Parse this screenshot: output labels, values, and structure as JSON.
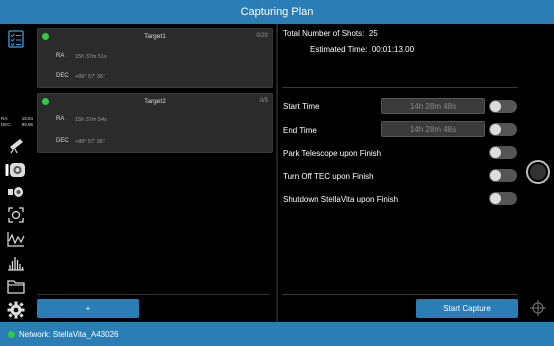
{
  "window": {
    "title": "Capturing Plan"
  },
  "sidebar": {
    "ra_label": "RA:",
    "ra_value": "15:64",
    "dec_label": "DEC:",
    "dec_value": "89.96",
    "icons": [
      "checklist-icon",
      "telescope-icon",
      "camera-icon",
      "focuser-icon",
      "focus-target-icon",
      "graph-icon",
      "histogram-icon",
      "folder-icon",
      "gear-icon"
    ]
  },
  "targets": [
    {
      "name": "Target1",
      "count": "0/20",
      "ra_label": "RA",
      "ra_value": "15h 37m 51s",
      "dec_label": "DEC",
      "dec_value": "+89° 57' 36\""
    },
    {
      "name": "Target2",
      "count": "0/5",
      "ra_label": "RA",
      "ra_value": "15h 37m 54s",
      "dec_label": "DEC",
      "dec_value": "+89° 57' 36\""
    }
  ],
  "add_button": "+",
  "plan": {
    "total_shots_label": "Total Number of Shots:",
    "total_shots_value": "25",
    "estimated_time_label": "Estimated Time:",
    "estimated_time_value": "00:01:13.00",
    "start_time_label": "Start Time",
    "start_time_value": "14h 28m 48s",
    "end_time_label": "End Time",
    "end_time_value": "14h 28m 48s",
    "park_label": "Park Telescope upon Finish",
    "tec_label": "Turn Off TEC upon Finish",
    "shutdown_label": "Shutdown StellaVita upon Finish",
    "start_button": "Start Capture"
  },
  "status": {
    "network": "Network: StellaVita_A43026"
  },
  "colors": {
    "accent": "#2a7db5",
    "online": "#2ecc40"
  }
}
